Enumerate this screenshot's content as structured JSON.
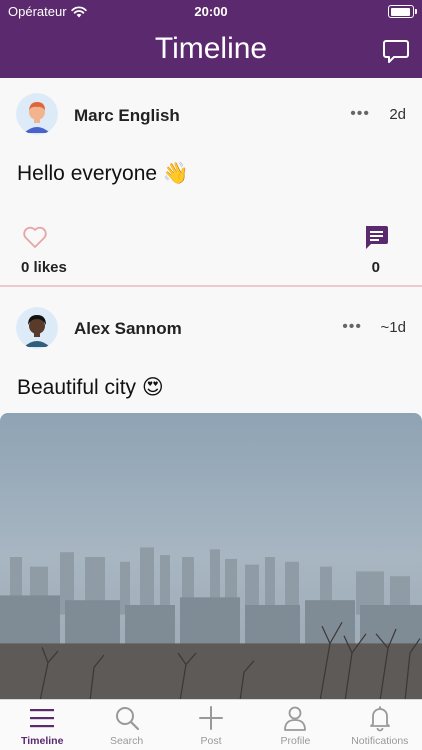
{
  "status_bar": {
    "carrier": "Opérateur",
    "time": "20:00"
  },
  "nav": {
    "title": "Timeline",
    "action_icon": "chat-bubble-icon"
  },
  "posts": [
    {
      "author": "Marc English",
      "time": "2d",
      "text": "Hello everyone 👋",
      "likes_label": "0 likes",
      "comments": "0",
      "more": "•••"
    },
    {
      "author": "Alex Sannom",
      "time": "~1d",
      "text": "Beautiful city 😍",
      "more": "•••"
    }
  ],
  "tabs": [
    {
      "label": "Timeline",
      "icon": "menu-lines-icon",
      "active": true
    },
    {
      "label": "Search",
      "icon": "search-icon"
    },
    {
      "label": "Post",
      "icon": "plus-icon"
    },
    {
      "label": "Profile",
      "icon": "person-icon"
    },
    {
      "label": "Notifications",
      "icon": "bell-icon"
    }
  ],
  "colors": {
    "brand": "#5b2a6e",
    "like_outline": "#e8a5a5",
    "tab_inactive": "#999999"
  }
}
